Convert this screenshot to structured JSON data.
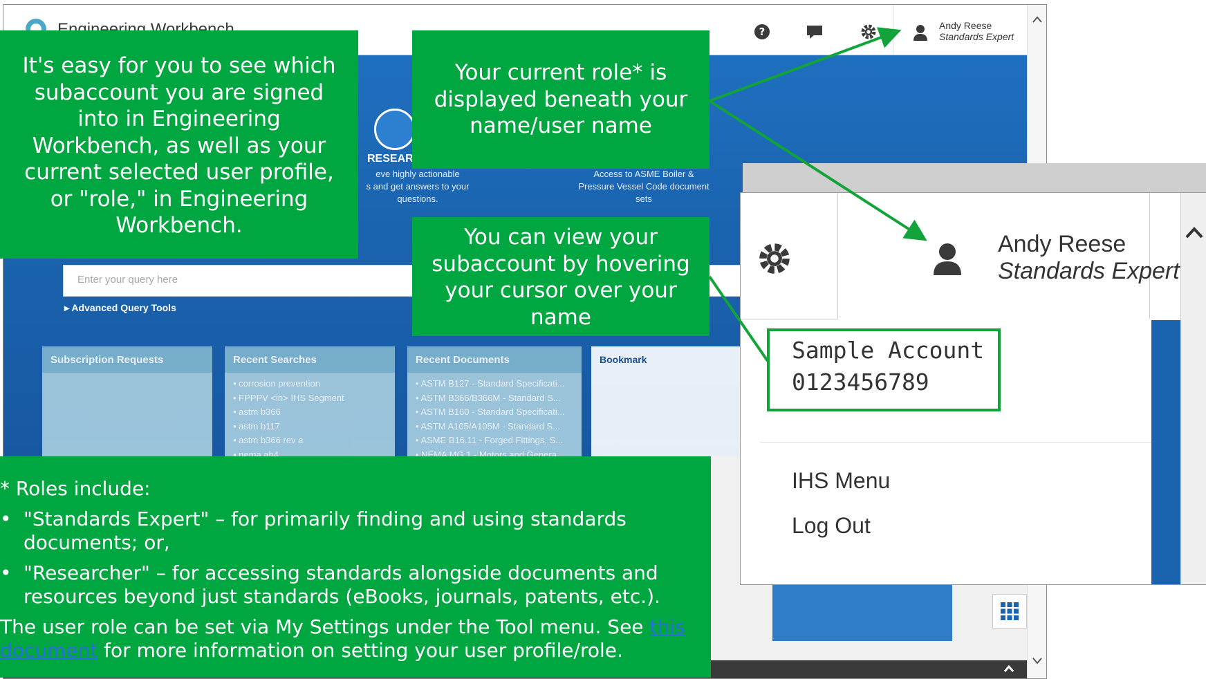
{
  "app": {
    "title": "Engineering Workbench",
    "user": {
      "name": "Andy Reese",
      "role": "Standards Expert"
    },
    "dropdown": {
      "account_name": "Sample Account",
      "account_number": "0123456789",
      "menu_items": [
        "IHS Menu",
        "Log Out"
      ]
    },
    "hero": {
      "research_label": "RESEAR",
      "research_desc": [
        "eve highly actionable",
        "s and get answers to your",
        "questions."
      ],
      "asme_desc": [
        "Access to ASME Boiler &",
        "Pressure Vessel Code document",
        "sets"
      ]
    },
    "search": {
      "placeholder": "Enter your query here",
      "advanced_label": "Advanced Query Tools"
    },
    "panels": {
      "subscription": {
        "title": "Subscription Requests"
      },
      "recent_searches": {
        "title": "Recent Searches",
        "items": [
          "corrosion prevention",
          "FPPPV <in> IHS Segment",
          "astm b366",
          "astm b117",
          "astm b366 rev a",
          "nema ab4"
        ]
      },
      "recent_documents": {
        "title": "Recent Documents",
        "items": [
          "ASTM B127 - Standard Specificati...",
          "ASTM B366/B366M - Standard S...",
          "ASTM B160 - Standard Specificati...",
          "ASTM A105/A105M - Standard S...",
          "ASME B16.11 - Forged Fittings, S...",
          "NEMA MG 1 - Motors and Genera..."
        ]
      },
      "bookmark": {
        "title": "Bookmark"
      }
    }
  },
  "callouts": {
    "left": [
      "It's easy for you to see which",
      "subaccount you are signed",
      "into in Engineering",
      "Workbench, as well as your",
      "current selected user profile,",
      "or \"role,\" in Engineering",
      "Workbench."
    ],
    "role": [
      "Your current role* is",
      "displayed beneath your",
      "name/user name"
    ],
    "subaccount": [
      "You can view your",
      "subaccount by hovering",
      "your cursor over your",
      "name"
    ]
  },
  "note": {
    "heading": "* Roles include:",
    "bullet1": [
      "\"Standards Expert\" – for primarily finding and using standards",
      "documents; or,"
    ],
    "bullet2": [
      "\"Researcher\" – for accessing standards alongside documents and",
      "resources beyond just standards (eBooks, journals, patents, etc.)."
    ],
    "line_a": "The user role can be set via My Settings under the Tool menu. See ",
    "link_a": "this",
    "link_b": "document",
    "line_b": " for more information on setting your user profile/role."
  },
  "colors": {
    "callout_green": "#00a63f",
    "highlight_green": "#12a33a",
    "app_blue": "#1a63ae",
    "link_blue": "#2b6fdb"
  },
  "icons": [
    "help-icon",
    "chat-icon",
    "gear-icon",
    "user-icon",
    "chevron-up-icon",
    "grid-icon",
    "arrow-icon"
  ]
}
